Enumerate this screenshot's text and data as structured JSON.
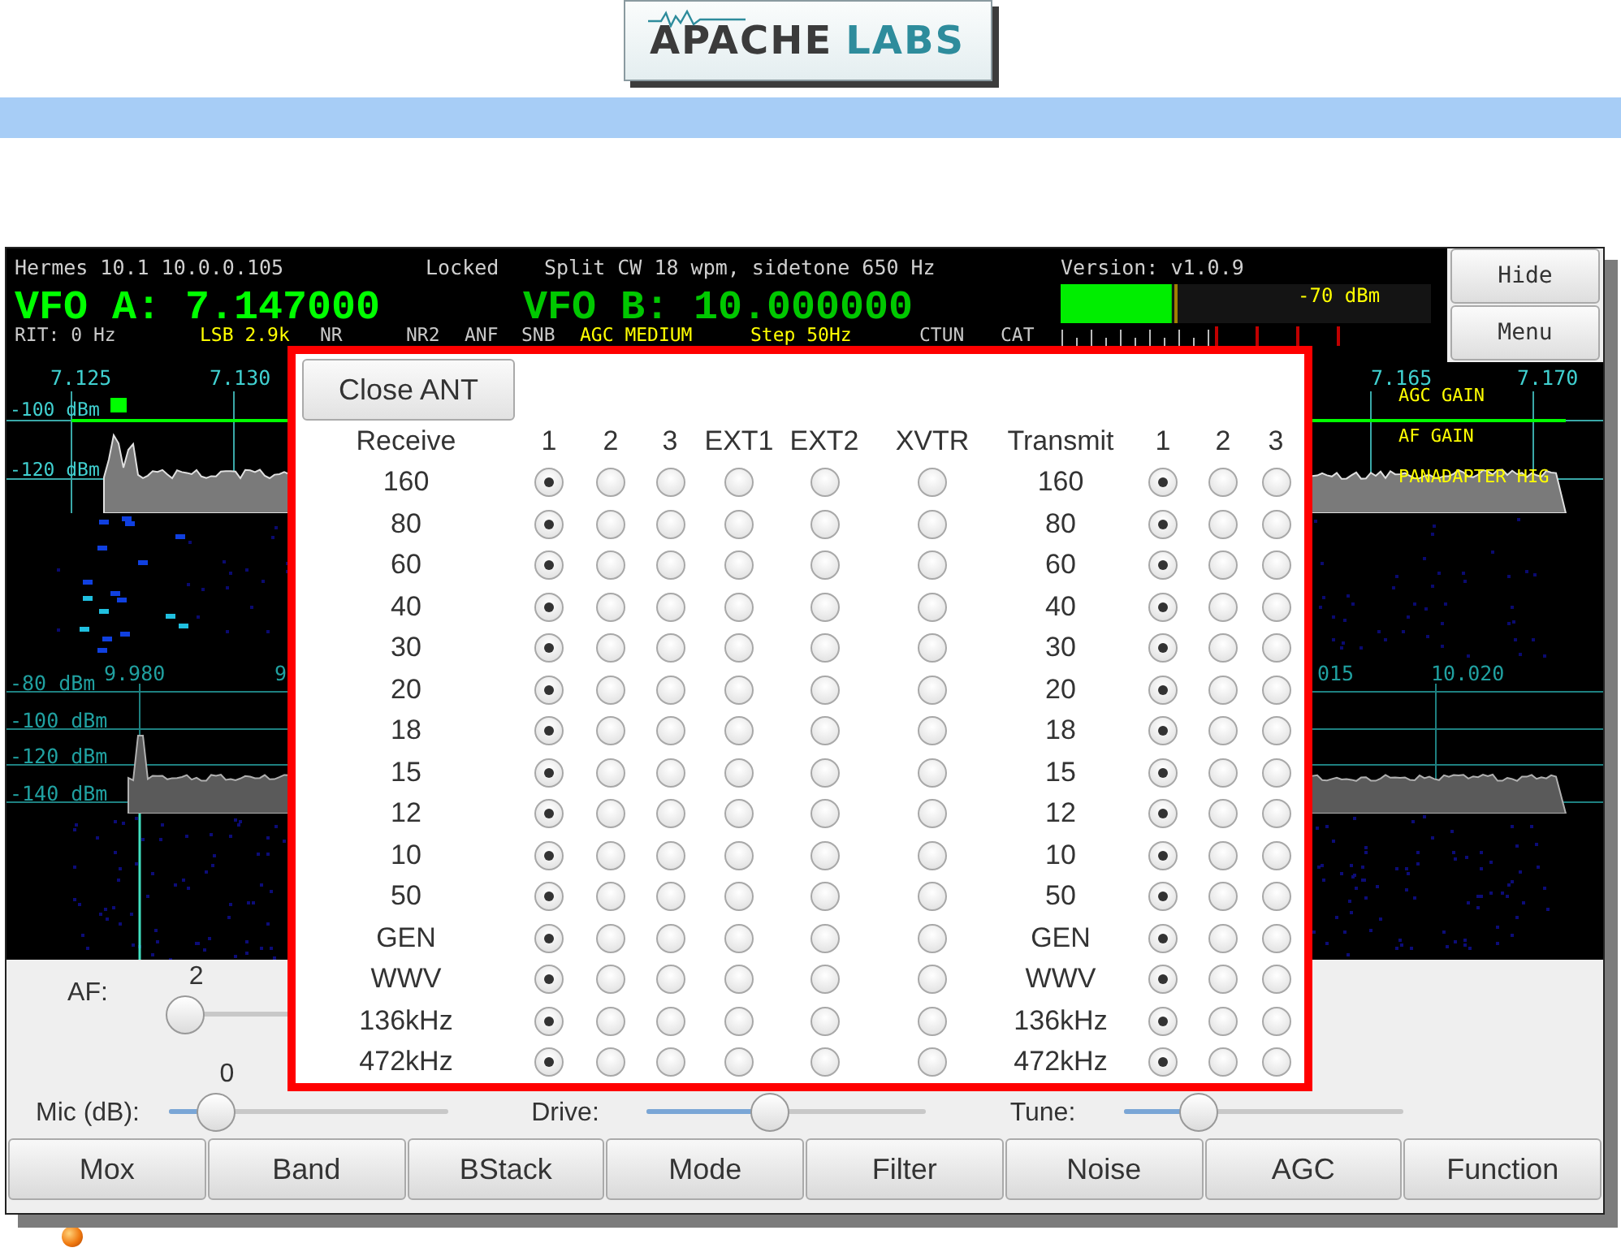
{
  "header": {
    "logo": [
      "APACHE",
      "LABS"
    ]
  },
  "app": {
    "status": {
      "radio": "Hermes 10.1 10.0.0.105",
      "lock": "Locked",
      "mode_info": "Split CW 18 wpm, sidetone 650 Hz",
      "version": "Version: v1.0.9"
    },
    "vfo_a": "VFO A: 7.147000",
    "vfo_b": "VFO B: 10.000000",
    "indicators": [
      {
        "label": "RIT: 0 Hz",
        "active": false
      },
      {
        "label": "LSB 2.9k",
        "active": true
      },
      {
        "label": "NR",
        "active": false
      },
      {
        "label": "NR2",
        "active": false
      },
      {
        "label": "ANF",
        "active": false
      },
      {
        "label": "SNB",
        "active": false
      },
      {
        "label": "AGC MEDIUM",
        "active": true
      },
      {
        "label": "Step 50Hz",
        "active": true
      },
      {
        "label": "CTUN",
        "active": false
      },
      {
        "label": "CAT",
        "active": false
      }
    ],
    "s_meter": {
      "level": 0.3,
      "reading": "-70 dBm"
    },
    "side_buttons": [
      "Hide",
      "Menu"
    ],
    "panadapter_a": {
      "freq_labels": [
        "7.125",
        "7.130",
        "7.165",
        "7.170"
      ],
      "dbm_labels": [
        "-100 dBm",
        "-120 dBm"
      ],
      "overlays": [
        "AGC GAIN",
        "AF GAIN",
        "PANADAPTER HIG"
      ]
    },
    "panadapter_b": {
      "freq_labels": [
        "9.980",
        "9",
        "015",
        "10.020"
      ],
      "dbm_labels": [
        "-80 dBm",
        "-100 dBm",
        "-120 dBm",
        "-140 dBm"
      ]
    },
    "controls": [
      {
        "label": "AF:",
        "value": "2",
        "level": 0.06
      },
      {
        "label": "Mic (dB):",
        "value": "0",
        "level": 0.17
      },
      {
        "label": "Drive:",
        "level": 0.44
      },
      {
        "label": "Tune:",
        "level": 0.27
      }
    ],
    "buttons": [
      "Mox",
      "Band",
      "BStack",
      "Mode",
      "Filter",
      "Noise",
      "AGC",
      "Function"
    ]
  },
  "ant_dialog": {
    "close_button": "Close ANT",
    "headers": [
      "Receive",
      "1",
      "2",
      "3",
      "EXT1",
      "EXT2",
      "XVTR",
      "Transmit",
      "1",
      "2",
      "3"
    ],
    "rows": [
      {
        "band": "160",
        "receive": [
          true,
          false,
          false,
          false,
          false,
          false
        ],
        "tx_band": "160",
        "transmit": [
          true,
          false,
          false
        ]
      },
      {
        "band": "80",
        "receive": [
          true,
          false,
          false,
          false,
          false,
          false
        ],
        "tx_band": "80",
        "transmit": [
          true,
          false,
          false
        ]
      },
      {
        "band": "60",
        "receive": [
          true,
          false,
          false,
          false,
          false,
          false
        ],
        "tx_band": "60",
        "transmit": [
          true,
          false,
          false
        ]
      },
      {
        "band": "40",
        "receive": [
          true,
          false,
          false,
          false,
          false,
          false
        ],
        "tx_band": "40",
        "transmit": [
          true,
          false,
          false
        ]
      },
      {
        "band": "30",
        "receive": [
          true,
          false,
          false,
          false,
          false,
          false
        ],
        "tx_band": "30",
        "transmit": [
          true,
          false,
          false
        ]
      },
      {
        "band": "20",
        "receive": [
          true,
          false,
          false,
          false,
          false,
          false
        ],
        "tx_band": "20",
        "transmit": [
          true,
          false,
          false
        ]
      },
      {
        "band": "18",
        "receive": [
          true,
          false,
          false,
          false,
          false,
          false
        ],
        "tx_band": "18",
        "transmit": [
          true,
          false,
          false
        ]
      },
      {
        "band": "15",
        "receive": [
          true,
          false,
          false,
          false,
          false,
          false
        ],
        "tx_band": "15",
        "transmit": [
          true,
          false,
          false
        ]
      },
      {
        "band": "12",
        "receive": [
          true,
          false,
          false,
          false,
          false,
          false
        ],
        "tx_band": "12",
        "transmit": [
          true,
          false,
          false
        ]
      },
      {
        "band": "10",
        "receive": [
          true,
          false,
          false,
          false,
          false,
          false
        ],
        "tx_band": "10",
        "transmit": [
          true,
          false,
          false
        ]
      },
      {
        "band": "50",
        "receive": [
          true,
          false,
          false,
          false,
          false,
          false
        ],
        "tx_band": "50",
        "transmit": [
          true,
          false,
          false
        ]
      },
      {
        "band": "GEN",
        "receive": [
          true,
          false,
          false,
          false,
          false,
          false
        ],
        "tx_band": "GEN",
        "transmit": [
          true,
          false,
          false
        ]
      },
      {
        "band": "WWV",
        "receive": [
          true,
          false,
          false,
          false,
          false,
          false
        ],
        "tx_band": "WWV",
        "transmit": [
          true,
          false,
          false
        ]
      },
      {
        "band": "136kHz",
        "receive": [
          true,
          false,
          false,
          false,
          false,
          false
        ],
        "tx_band": "136kHz",
        "transmit": [
          true,
          false,
          false
        ]
      },
      {
        "band": "472kHz",
        "receive": [
          true,
          false,
          false,
          false,
          false,
          false
        ],
        "tx_band": "472kHz",
        "transmit": [
          true,
          false,
          false
        ]
      }
    ]
  }
}
